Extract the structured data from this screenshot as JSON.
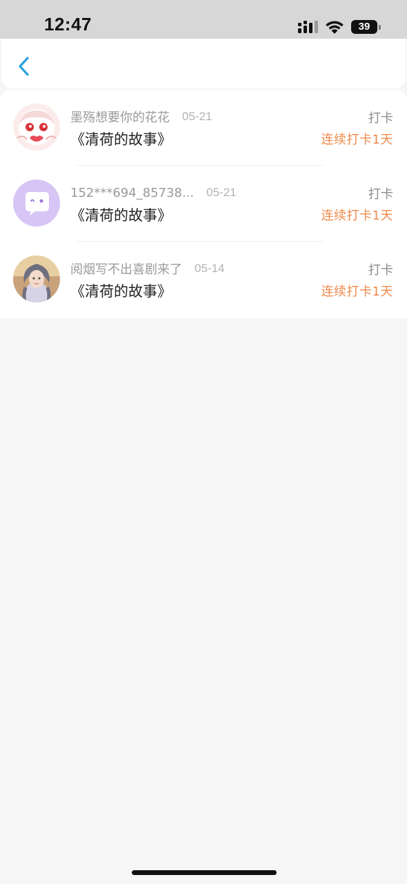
{
  "status_bar": {
    "time": "12:47",
    "battery": "39",
    "icons": [
      "signal-icon",
      "wifi-icon",
      "battery-icon"
    ]
  },
  "header": {
    "back_icon": "chevron-left-icon",
    "accent_color": "#2aa0e0"
  },
  "list": {
    "items": [
      {
        "username": "墨殇想要你的花花",
        "date": "05-21",
        "book_title": "《清荷的故事》",
        "action": "打卡",
        "streak": "连续打卡1天",
        "avatar": "anime-girl-avatar"
      },
      {
        "username": "152***694_85738...",
        "date": "05-21",
        "book_title": "《清荷的故事》",
        "action": "打卡",
        "streak": "连续打卡1天",
        "avatar": "default-chat-avatar"
      },
      {
        "username": "阅烟写不出喜剧来了",
        "date": "05-14",
        "book_title": "《清荷的故事》",
        "action": "打卡",
        "streak": "连续打卡1天",
        "avatar": "portrait-avatar"
      }
    ]
  },
  "colors": {
    "streak": "#f08a4b",
    "username": "#9a9a9a",
    "title": "#222222",
    "background": "#f6f6f6"
  }
}
